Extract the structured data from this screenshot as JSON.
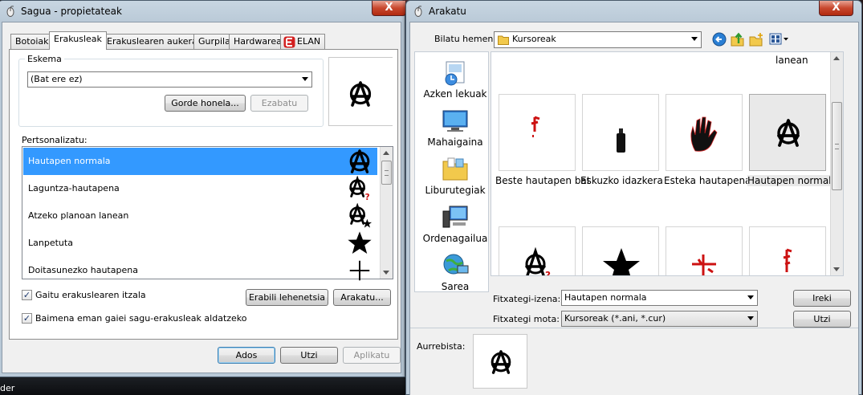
{
  "left_window": {
    "title": "Sagua - propietateak",
    "close_label": "X",
    "tabs": [
      "Botoiak",
      "Erakusleak",
      "Erakuslearen aukerak",
      "Gurpila",
      "Hardwarea",
      "ELAN"
    ],
    "active_tab": "Erakusleak",
    "scheme_label": "Eskema",
    "scheme_value": "(Bat ere ez)",
    "save_as_label": "Gorde honela...",
    "delete_label": "Ezabatu",
    "customize_label": "Pertsonalizatu:",
    "cursor_items": [
      {
        "label": "Hautapen normala",
        "icon": "anarchy-icon",
        "selected": true
      },
      {
        "label": "Laguntza-hautapena",
        "icon": "anarchy-question-icon",
        "selected": false
      },
      {
        "label": "Atzeko planoan lanean",
        "icon": "anarchy-star-icon",
        "selected": false
      },
      {
        "label": "Lanpetuta",
        "icon": "star-icon",
        "selected": false
      },
      {
        "label": "Doitasunezko hautapena",
        "icon": "crosshair-icon",
        "selected": false
      }
    ],
    "enable_shadow_label": "Gaitu erakuslearen itzala",
    "enable_shadow_checked": true,
    "use_default_label": "Erabili lehenetsia",
    "browse_label": "Arakatu...",
    "allow_themes_label": "Baimena eman gaiei sagu-erakusleak aldatzeko",
    "allow_themes_checked": true,
    "ok_label": "Ados",
    "cancel_label": "Utzi",
    "apply_label": "Aplikatu"
  },
  "right_window": {
    "title": "Arakatu",
    "close_label": "X",
    "look_in_label": "Bilatu hemen:",
    "look_in_value": "Kursoreak",
    "places": [
      {
        "label": "Azken lekuak",
        "icon": "recent-places-icon"
      },
      {
        "label": "Mahaigaina",
        "icon": "desktop-icon"
      },
      {
        "label": "Liburutegiak",
        "icon": "libraries-icon"
      },
      {
        "label": "Ordenagailua",
        "icon": "computer-icon"
      },
      {
        "label": "Sarea",
        "icon": "network-icon"
      }
    ],
    "partial_caption": "lanean",
    "files_row1": [
      {
        "label": "Beste hautapen bat",
        "icon": "red-arrow-icon",
        "selected": false
      },
      {
        "label": "Eskuzko idazkera",
        "icon": "spray-can-icon",
        "selected": false
      },
      {
        "label": "Esteka hautapena",
        "icon": "hand-icon",
        "selected": false
      },
      {
        "label": "Hautapen normala",
        "icon": "anarchy-icon",
        "selected": true
      }
    ],
    "files_row2": [
      {
        "icon": "anarchy-question-icon"
      },
      {
        "icon": "star-icon"
      },
      {
        "icon": "red-cross-icon"
      },
      {
        "icon": "red-arrow-icon"
      }
    ],
    "filename_label": "Fitxategi-izena:",
    "filename_value": "Hautapen normala",
    "filetype_label": "Fitxategi mota:",
    "filetype_value": "Kursoreak (*.ani, *.cur)",
    "open_label": "Ireki",
    "cancel_label": "Utzi",
    "preview_label": "Aurrebista:"
  },
  "taskbar_fragment": "der",
  "colors": {
    "selection": "#3399ff",
    "close_button": "#c8482e",
    "accent_red": "#cc1111"
  }
}
